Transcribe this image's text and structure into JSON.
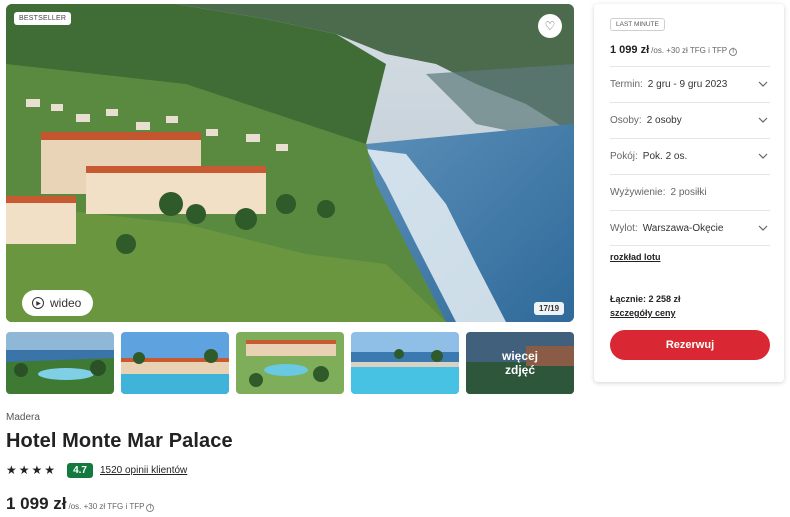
{
  "gallery": {
    "badge": "BESTSELLER",
    "favorite_icon": "heart-icon",
    "video_label": "wideo",
    "counter": "17/19",
    "more_label": "więcej zdjęć"
  },
  "hotel": {
    "region": "Madera",
    "name": "Hotel Monte Mar Palace",
    "stars": 4,
    "score": "4.7",
    "reviews": "1520 opinii klientów",
    "price": "1 099 zł",
    "price_suffix": "/os. +30 zł TFG i TFP"
  },
  "booking": {
    "badge": "LAST MINUTE",
    "price": "1 099 zł",
    "price_suffix": "/os. +30 zł TFG i TFP",
    "rows": [
      {
        "label": "Termin:",
        "value": "2 gru - 9 gru 2023",
        "chevron": true
      },
      {
        "label": "Osoby:",
        "value": "2 osoby",
        "chevron": true
      },
      {
        "label": "Pokój:",
        "value": "Pok. 2 os.",
        "chevron": true
      },
      {
        "label": "Wyżywienie:",
        "value": "2 posiłki",
        "chevron": false
      },
      {
        "label": "Wylot:",
        "value": "Warszawa-Okęcie",
        "chevron": true
      }
    ],
    "flight_link": "rozkład lotu",
    "total": "Łącznie: 2 258 zł",
    "details_link": "szczegóły ceny",
    "reserve_label": "Rezerwuj"
  },
  "colors": {
    "accent": "#d92833",
    "score_bg": "#137a3d"
  }
}
